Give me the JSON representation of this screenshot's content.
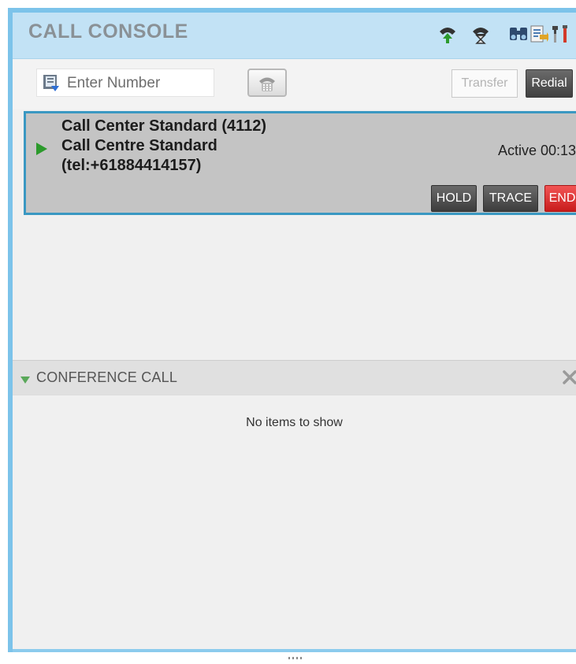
{
  "header": {
    "title": "CALL CONSOLE",
    "icons": [
      "call-icon",
      "call-wait-icon",
      "directory-icon",
      "notes-icon",
      "settings-icon"
    ]
  },
  "dialer": {
    "placeholder": "Enter Number",
    "value": "",
    "transfer_label": "Transfer",
    "redial_label": "Redial"
  },
  "active_call": {
    "line1": "Call Center Standard (4112)",
    "line2": "Call Centre Standard",
    "line3": "(tel:+61884414157)",
    "status": "Active 00:13",
    "hold_label": "HOLD",
    "trace_label": "TRACE",
    "end_label": "END"
  },
  "conference": {
    "title": "CONFERENCE CALL",
    "empty_text": "No items to show"
  },
  "colors": {
    "accent": "#7cc3ea",
    "header_bg": "#c2e2f5",
    "active_border": "#3a98c2",
    "end_button": "#d92a2a",
    "call_green": "#2c9a2c"
  }
}
